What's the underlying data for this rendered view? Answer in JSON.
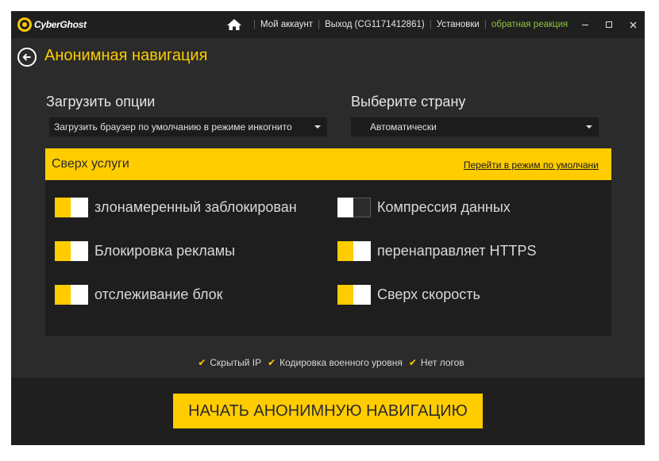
{
  "app": {
    "logo_text": "CyberGhost"
  },
  "topnav": {
    "account": "Мой аккаунт",
    "logout": "Выход (CG1171412861)",
    "settings": "Установки",
    "feedback": "обратная реакция"
  },
  "header": {
    "title": "Анонимная навигация"
  },
  "options": {
    "load_label": "Загрузить опции",
    "load_value": "Загрузить браузер по умолчанию в режиме инкогнито",
    "country_label": "Выберите страну",
    "country_value": "Автоматически"
  },
  "services": {
    "title": "Сверх услуги",
    "default_link": "Перейти в режим по умолчани",
    "items": [
      {
        "label": "злонамеренный заблокирован",
        "on": true
      },
      {
        "label": "Компрессия данных",
        "on": false
      },
      {
        "label": "Блокировка рекламы",
        "on": true
      },
      {
        "label": "перенаправляет HTTPS",
        "on": true
      },
      {
        "label": "отслеживание блок",
        "on": true
      },
      {
        "label": "Сверх скорость",
        "on": true
      }
    ]
  },
  "features": [
    "Скрытый IP",
    "Кодировка военного уровня",
    "Нет логов"
  ],
  "actions": {
    "start": "НАЧАТЬ АНОНИМНУЮ НАВИГАЦИЮ"
  },
  "colors": {
    "accent": "#ffcc00",
    "feedback": "#8dc63f",
    "background": "#2b2b2b"
  }
}
